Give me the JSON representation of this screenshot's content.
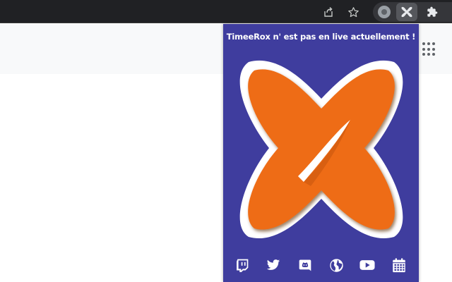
{
  "browser": {
    "toolbar_icons": [
      "share-icon",
      "star-icon",
      "profile-avatar",
      "extension-x-icon",
      "puzzle-icon"
    ]
  },
  "popup": {
    "title": "TimeeRox n' est pas en live actuellement !",
    "colors": {
      "background": "#3f3d9e",
      "logo_orange": "#ee6c17",
      "logo_border": "#ffffff"
    },
    "social_icons": [
      "twitch-icon",
      "twitter-icon",
      "discord-icon",
      "globe-icon",
      "youtube-icon",
      "calendar-icon"
    ]
  }
}
